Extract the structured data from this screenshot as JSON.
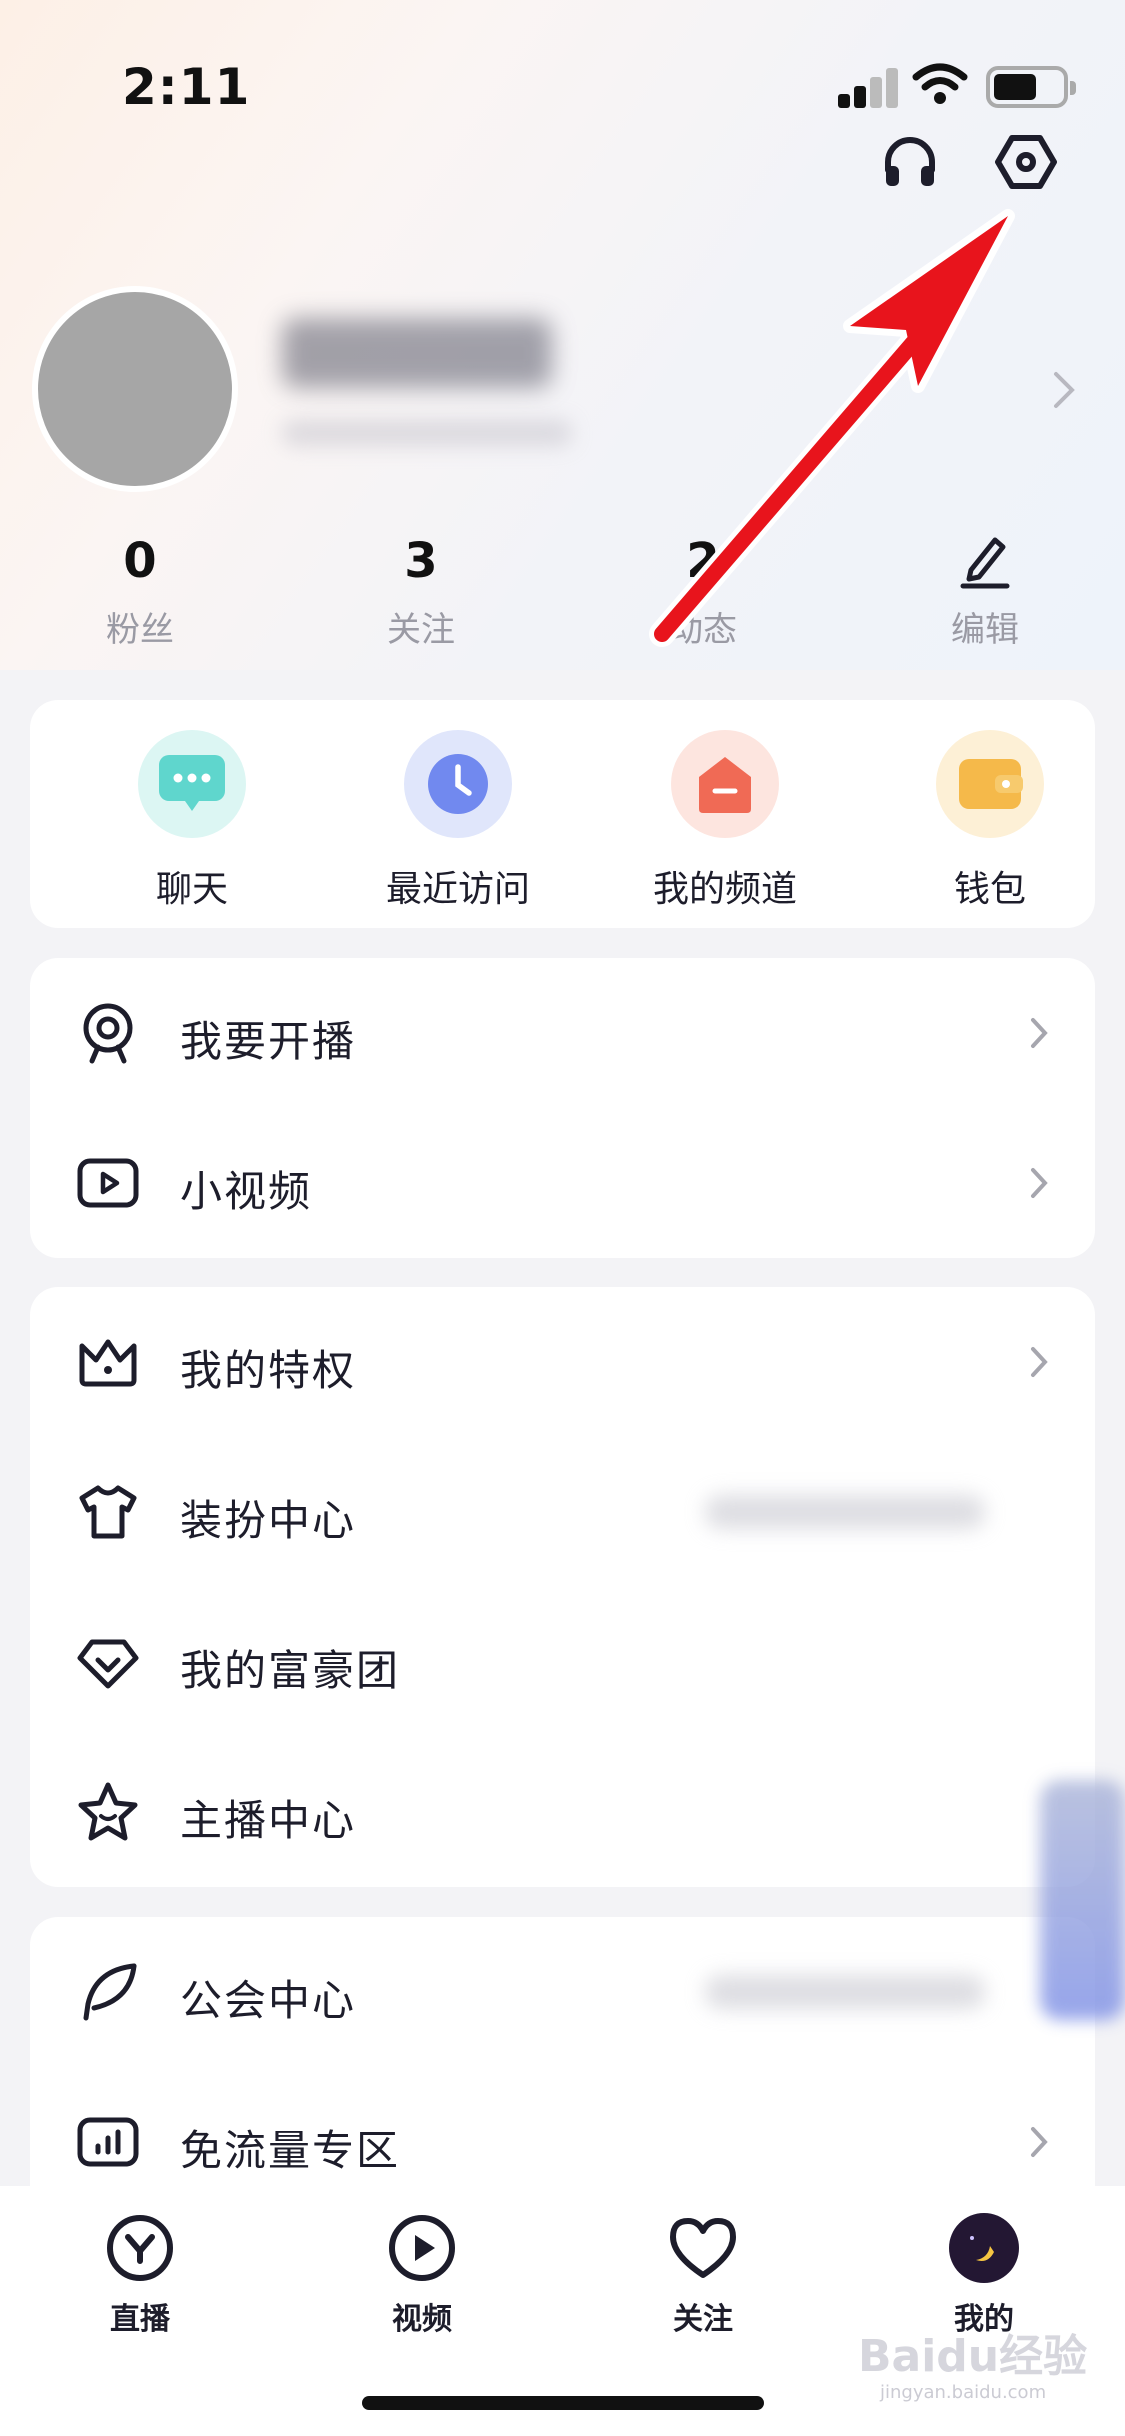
{
  "status_bar": {
    "time": "2:11"
  },
  "stats": [
    {
      "value": "0",
      "label": "粉丝"
    },
    {
      "value": "3",
      "label": "关注"
    },
    {
      "value": "2",
      "label": "动态"
    }
  ],
  "edit": {
    "label": "编辑"
  },
  "quick_actions": [
    {
      "label": "聊天",
      "icon": "chat-bubble-icon",
      "color": "#5fd6cd"
    },
    {
      "label": "最近访问",
      "icon": "clock-icon",
      "color": "#7189ef"
    },
    {
      "label": "我的频道",
      "icon": "channel-house-icon",
      "color": "#f06a55"
    },
    {
      "label": "钱包",
      "icon": "wallet-icon",
      "color": "#f5b94a"
    }
  ],
  "menu_group_1": [
    {
      "label": "我要开播",
      "icon": "webcam-icon"
    },
    {
      "label": "小视频",
      "icon": "video-play-icon"
    }
  ],
  "menu_group_2": [
    {
      "label": "我的特权",
      "icon": "crown-icon"
    },
    {
      "label": "装扮中心",
      "icon": "tshirt-icon"
    },
    {
      "label": "我的富豪团",
      "icon": "diamond-icon"
    },
    {
      "label": "主播中心",
      "icon": "star-icon"
    }
  ],
  "menu_group_3": [
    {
      "label": "公会中心",
      "icon": "feather-icon"
    },
    {
      "label": "免流量专区",
      "icon": "data-chart-icon"
    }
  ],
  "bottom_nav": [
    {
      "label": "直播",
      "icon": "live-y-icon"
    },
    {
      "label": "视频",
      "icon": "video-icon"
    },
    {
      "label": "关注",
      "icon": "heart-icon"
    },
    {
      "label": "我的",
      "icon": "avatar-moon-icon"
    }
  ],
  "watermark": {
    "text": "Baidu经验",
    "sub": "jingyan.baidu.com"
  }
}
